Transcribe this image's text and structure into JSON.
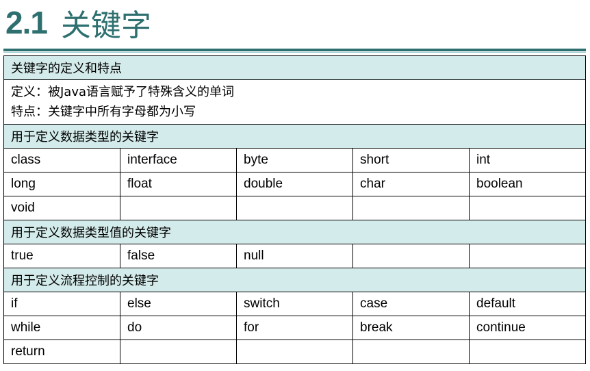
{
  "slide": {
    "number": "2.1",
    "title": "关键字"
  },
  "table": {
    "sec_definition": "关键字的定义和特点",
    "definition_line": "定义：被Java语言赋予了特殊含义的单词",
    "feature_line": "特点：关键字中所有字母都为小写",
    "sec_data_types": "用于定义数据类型的关键字",
    "data_types": [
      [
        "class",
        "interface",
        "byte",
        "short",
        "int"
      ],
      [
        "long",
        "float",
        "double",
        "char",
        "boolean"
      ],
      [
        "void",
        "",
        "",
        "",
        ""
      ]
    ],
    "sec_data_values": "用于定义数据类型值的关键字",
    "data_values": [
      [
        "true",
        "false",
        "null",
        "",
        ""
      ]
    ],
    "sec_flow_control": "用于定义流程控制的关键字",
    "flow_control": [
      [
        "if",
        "else",
        "switch",
        "case",
        "default"
      ],
      [
        "while",
        "do",
        "for",
        "break",
        "continue"
      ],
      [
        "return",
        "",
        "",
        "",
        ""
      ]
    ]
  },
  "colors": {
    "title": "#2e6f6f",
    "section_bg": "#d3ebea"
  }
}
